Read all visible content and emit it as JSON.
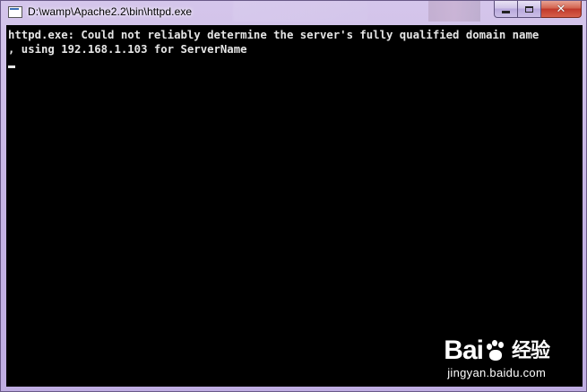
{
  "window": {
    "title": "D:\\wamp\\Apache2.2\\bin\\httpd.exe",
    "app_icon": "console-window-icon",
    "controls": {
      "minimize": "minimize-icon",
      "maximize": "maximize-icon",
      "close": "close-icon",
      "close_glyph": "✕"
    }
  },
  "console": {
    "lines": [
      "httpd.exe: Could not reliably determine the server's fully qualified domain name",
      ", using 192.168.1.103 for ServerName"
    ],
    "text_color": "#e6e6e6",
    "background": "#000000"
  },
  "watermark": {
    "logo_left": "Bai",
    "logo_right": "经验",
    "url": "jingyan.baidu.com"
  }
}
